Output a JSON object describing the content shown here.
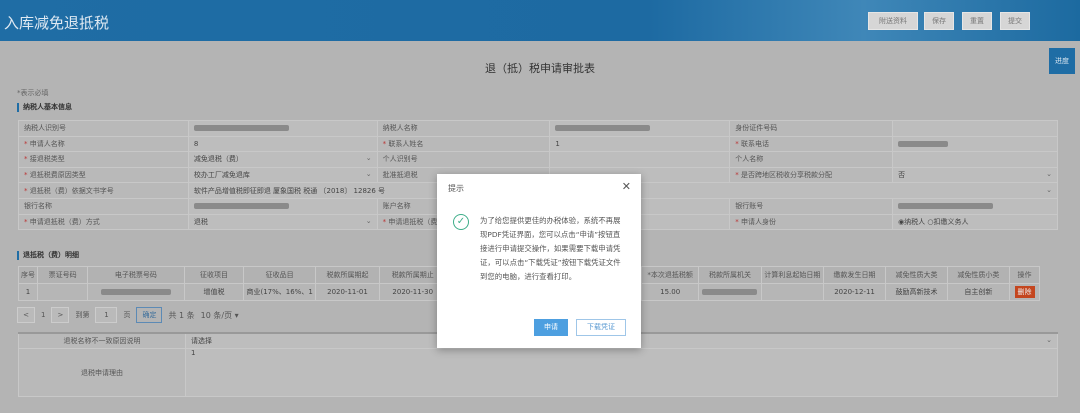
{
  "header": {
    "title": "入库减免退抵税",
    "buttons": [
      "附送资料",
      "保存",
      "重置",
      "提交"
    ]
  },
  "page_title": "退（抵）税申请审批表",
  "progress_button": "进度",
  "required_note": "*表示必填",
  "section_basic": "纳税人基本信息",
  "basic_rows": [
    [
      {
        "l": "纳税人识别号"
      },
      {
        "v": "",
        "blur": 1
      },
      {
        "l": "纳税人名称"
      },
      {
        "v": "",
        "blur": 1
      },
      {
        "l": "身份证件号码"
      },
      {
        "v": ""
      }
    ],
    [
      {
        "l": "申请人名称",
        "req": 1
      },
      {
        "v": "8"
      },
      {
        "l": "联系人姓名",
        "req": 1
      },
      {
        "v": "1"
      },
      {
        "l": "联系电话",
        "req": 1
      },
      {
        "v": "",
        "blur": 1
      }
    ],
    [
      {
        "l": "接退税类型",
        "req": 1
      },
      {
        "v": "减免退税（费）",
        "sel": 1
      },
      {
        "l": "个人识别号"
      },
      {
        "v": ""
      },
      {
        "l": "个人名称"
      },
      {
        "v": ""
      }
    ],
    [
      {
        "l": "退抵税费原因类型",
        "req": 1
      },
      {
        "v": "校办工厂减免退库",
        "sel": 1
      },
      {
        "l": "批准抵退税"
      },
      {
        "v": ""
      },
      {
        "l": "是否跨地区税收分享税款分配",
        "req": 1
      },
      {
        "v": "否",
        "sel": 1
      }
    ],
    [
      {
        "l": "退抵税（费）依据文书字号",
        "req": 1
      },
      {
        "v": "软件产品增值税即征即退 厦象国税 税通 〔2018〕 12826 号",
        "span": 5
      }
    ],
    [
      {
        "l": "银行名称"
      },
      {
        "v": "",
        "blur": 1
      },
      {
        "l": "账户名称"
      },
      {
        "v": ""
      },
      {
        "l": "银行账号"
      },
      {
        "v": "",
        "blur": 1
      }
    ],
    [
      {
        "l": "申请退抵税（费）方式",
        "req": 1
      },
      {
        "v": "退税",
        "sel": 1
      },
      {
        "l": "申请退抵税（费）",
        "req": 1
      },
      {
        "v": ""
      },
      {
        "l": "申请人身份",
        "req": 1
      },
      {
        "v": "◉纳税人  ○扣缴义务人"
      }
    ]
  ],
  "section_detail": "退抵税（费）明细",
  "detail_headers": [
    "序号",
    "票证号码",
    "电子税票号码",
    "征收项目",
    "征收品目",
    "税款所属期起",
    "税款所属期止",
    "",
    "",
    "*本次退抵税额",
    "税款所属机关",
    "计算利息起始日期",
    "缴款发生日期",
    "减免性质大类",
    "减免性质小类",
    "操作"
  ],
  "detail_row": [
    "1",
    "",
    "",
    "增值税",
    "商业(17%、16%、1",
    "2020-11-01",
    "2020-11-30",
    "",
    "",
    "15.00",
    "",
    "",
    "2020-12-11",
    "鼓励高新技术",
    "自主创新"
  ],
  "delete_label": "删除",
  "pagination": {
    "prev": "<",
    "page": "1",
    "next": ">",
    "goto": "到第",
    "input": "1",
    "page_unit": "页",
    "confirm": "确定",
    "total": "共 1 条",
    "per_page": "10 条/页 ▾"
  },
  "bottom": {
    "r1_label": "退税名称不一致原因说明",
    "r1_value": "请选择",
    "r2_label": "退税申请理由",
    "r2_value": "1"
  },
  "modal": {
    "title": "提示",
    "message": "为了给您提供更佳的办税体验，系统不再展现PDF凭证界面，您可以点击“申请”按钮直接进行申请提交操作，如果需要下载申请凭证，可以点击“下载凭证”按钮下载凭证文件到您的电脑，进行查看打印。",
    "apply": "申请",
    "download": "下载凭证"
  }
}
